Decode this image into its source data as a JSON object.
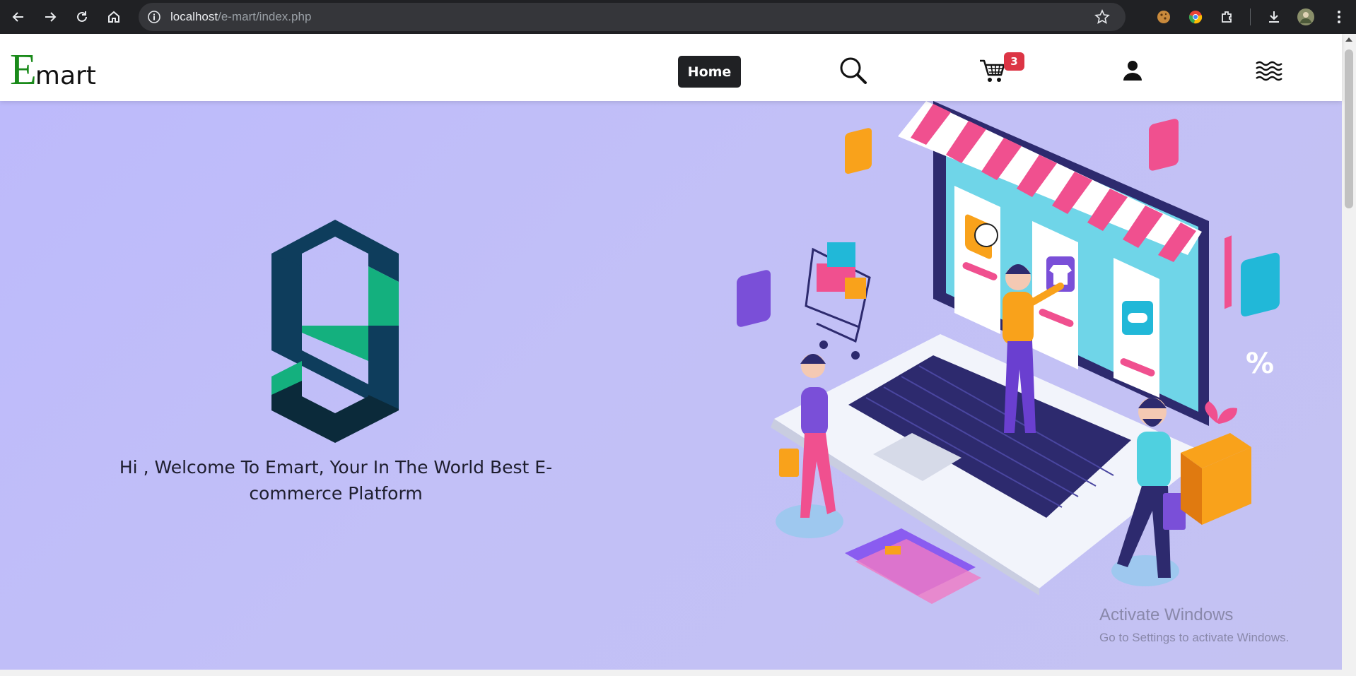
{
  "browser": {
    "url_host": "localhost",
    "url_path": "/e-mart/index.php",
    "icons": [
      "back-icon",
      "forward-icon",
      "reload-icon",
      "home-icon",
      "site-info-icon",
      "bookmark-star-icon",
      "cookie-extension-icon",
      "chrome-extension-icon",
      "extensions-puzzle-icon",
      "download-icon",
      "profile-avatar",
      "menu-kebab-icon"
    ]
  },
  "header": {
    "logo_initial": "E",
    "logo_rest": "mart",
    "nav_home": "Home",
    "cart_count": "3",
    "icons": [
      "search-icon",
      "cart-icon",
      "user-icon",
      "menu-waves-icon"
    ]
  },
  "hero": {
    "welcome_text": "Hi , Welcome To Emart, Your In The World Best E-commerce Platform",
    "colors": {
      "background": "#bdbafb",
      "mark_dark": "#0e3d5c",
      "mark_green": "#14b07e",
      "mark_navy": "#0b2a3a"
    }
  },
  "watermark": {
    "title": "Activate Windows",
    "subtitle": "Go to Settings to activate Windows."
  }
}
